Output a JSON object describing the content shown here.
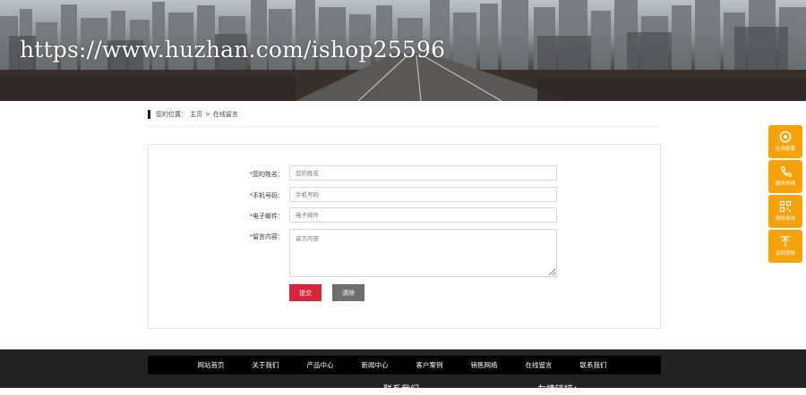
{
  "watermark": "https://www.huzhan.com/ishop25596",
  "breadcrumb": {
    "prefix": "您的位置：",
    "home": "主页",
    "separator": ">",
    "current": "在线留言"
  },
  "form": {
    "name_label": "您的姓名：",
    "name_placeholder": "您的姓名",
    "phone_label": "手机号码：",
    "phone_placeholder": "手机号码",
    "email_label": "电子邮件：",
    "email_placeholder": "电子邮件",
    "message_label": "留言内容：",
    "message_placeholder": "留言内容",
    "required_mark": "*",
    "submit_label": "提交",
    "clear_label": "清除"
  },
  "sidebar": {
    "items": [
      {
        "label": "在线客服",
        "icon": "headset-icon"
      },
      {
        "label": "服务热线",
        "icon": "phone-icon"
      },
      {
        "label": "微信咨询",
        "icon": "qrcode-icon"
      },
      {
        "label": "返回顶部",
        "icon": "back-to-top-icon"
      }
    ]
  },
  "footer": {
    "nav": [
      "网站首页",
      "关于我们",
      "产品中心",
      "新闻中心",
      "客户案例",
      "销售网络",
      "在线留言",
      "联系我们"
    ],
    "contact_heading": "联系我们",
    "links_heading": "友情链接："
  },
  "colors": {
    "accent": "#f5a20b",
    "submit": "#d6243a",
    "clear": "#6f6f6f",
    "footer_bg": "#232323"
  }
}
